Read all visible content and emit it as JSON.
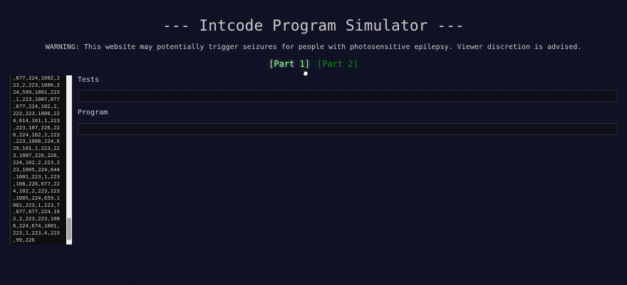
{
  "header": {
    "title": "--- Intcode Program Simulator ---",
    "warning": "WARNING: This website may potentially trigger seizures for people with photosensitive epilepsy. Viewer discretion is advised."
  },
  "nav": {
    "part1_label": "[Part 1]",
    "part2_label": "[Part 2]",
    "active": "part1"
  },
  "memory": {
    "lines": [
      ",677,224,1002,2",
      "23,2,223,1006,2",
      "24,599,1001,223",
      ",1,223,1007,677",
      ",677,224,102,2,",
      "223,223,1006,22",
      "4,614,101,1,223",
      ",223,107,226,22",
      "6,224,102,2,223",
      ",223,1006,224,6",
      "29,101,1,223,22",
      "3,1007,226,226,",
      "224,102,2,223,2",
      "23,1005,224,644",
      ",1001,223,1,223",
      ",108,226,677,22",
      "4,102,2,223,223",
      ",1005,224,659,1",
      "001,223,1,223,7",
      ",677,677,224,10",
      "2,2,223,223,100",
      "6,224,674,1001,",
      "223,1,223,4,223",
      ",99,226"
    ]
  },
  "form": {
    "tests_label": "Tests",
    "tests_value": "",
    "program_label": "Program",
    "program_value": ""
  },
  "icons": {
    "cursor": "pointer-hand-icon"
  },
  "colors": {
    "background": "#0f0f23",
    "text": "#cccccc",
    "link_active": "#99ff99",
    "link": "#009900"
  }
}
